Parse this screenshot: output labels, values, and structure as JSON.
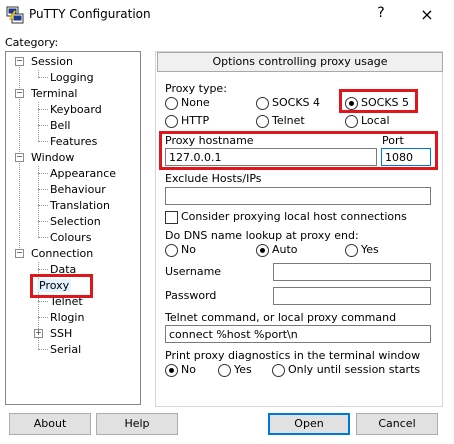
{
  "window": {
    "title": "PuTTY Configuration",
    "help_symbol": "?",
    "close_symbol": "×",
    "app_icon": "putty-icon"
  },
  "category": {
    "label": "Category:",
    "items": [
      {
        "label": "Session"
      },
      {
        "label": "Logging"
      },
      {
        "label": "Terminal"
      },
      {
        "label": "Keyboard"
      },
      {
        "label": "Bell"
      },
      {
        "label": "Features"
      },
      {
        "label": "Window"
      },
      {
        "label": "Appearance"
      },
      {
        "label": "Behaviour"
      },
      {
        "label": "Translation"
      },
      {
        "label": "Selection"
      },
      {
        "label": "Colours"
      },
      {
        "label": "Connection"
      },
      {
        "label": "Data"
      },
      {
        "label": "Proxy",
        "selected": true
      },
      {
        "label": "Telnet"
      },
      {
        "label": "Rlogin"
      },
      {
        "label": "SSH"
      },
      {
        "label": "Serial"
      }
    ]
  },
  "panel": {
    "header": "Options controlling proxy usage",
    "proxy_type": {
      "label": "Proxy type:",
      "options": [
        "None",
        "SOCKS 4",
        "SOCKS 5",
        "HTTP",
        "Telnet",
        "Local"
      ],
      "selected": "SOCKS 5"
    },
    "hostname_label": "Proxy hostname",
    "hostname_value": "127.0.0.1",
    "port_label": "Port",
    "port_value": "1080",
    "exclude_label": "Exclude Hosts/IPs",
    "exclude_value": "",
    "consider_local_label": "Consider proxying local host connections",
    "consider_local_checked": false,
    "dns": {
      "label": "Do DNS name lookup at proxy end:",
      "options": [
        "No",
        "Auto",
        "Yes"
      ],
      "selected": "Auto"
    },
    "username_label": "Username",
    "username_value": "",
    "password_label": "Password",
    "password_value": "",
    "telnet_cmd_label": "Telnet command, or local proxy command",
    "telnet_cmd_value": "connect %host %port\\n",
    "diag": {
      "label": "Print proxy diagnostics in the terminal window",
      "options": [
        "No",
        "Yes",
        "Only until session starts"
      ],
      "selected": "No"
    }
  },
  "buttons": {
    "about": "About",
    "help": "Help",
    "open": "Open",
    "cancel": "Cancel"
  },
  "highlight_color": "#e0161d"
}
